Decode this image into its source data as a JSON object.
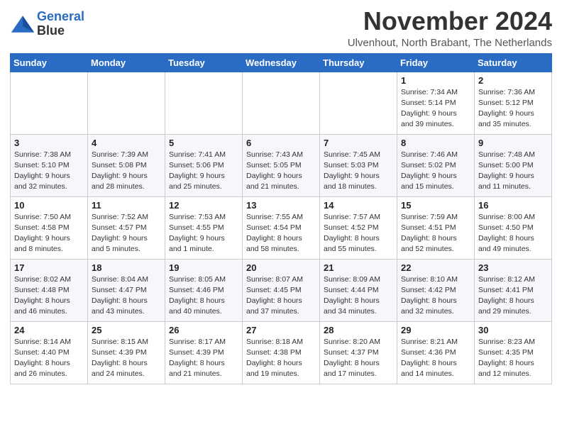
{
  "logo": {
    "line1": "General",
    "line2": "Blue"
  },
  "title": "November 2024",
  "location": "Ulvenhout, North Brabant, The Netherlands",
  "days_of_week": [
    "Sunday",
    "Monday",
    "Tuesday",
    "Wednesday",
    "Thursday",
    "Friday",
    "Saturday"
  ],
  "weeks": [
    [
      {
        "day": "",
        "info": ""
      },
      {
        "day": "",
        "info": ""
      },
      {
        "day": "",
        "info": ""
      },
      {
        "day": "",
        "info": ""
      },
      {
        "day": "",
        "info": ""
      },
      {
        "day": "1",
        "info": "Sunrise: 7:34 AM\nSunset: 5:14 PM\nDaylight: 9 hours\nand 39 minutes."
      },
      {
        "day": "2",
        "info": "Sunrise: 7:36 AM\nSunset: 5:12 PM\nDaylight: 9 hours\nand 35 minutes."
      }
    ],
    [
      {
        "day": "3",
        "info": "Sunrise: 7:38 AM\nSunset: 5:10 PM\nDaylight: 9 hours\nand 32 minutes."
      },
      {
        "day": "4",
        "info": "Sunrise: 7:39 AM\nSunset: 5:08 PM\nDaylight: 9 hours\nand 28 minutes."
      },
      {
        "day": "5",
        "info": "Sunrise: 7:41 AM\nSunset: 5:06 PM\nDaylight: 9 hours\nand 25 minutes."
      },
      {
        "day": "6",
        "info": "Sunrise: 7:43 AM\nSunset: 5:05 PM\nDaylight: 9 hours\nand 21 minutes."
      },
      {
        "day": "7",
        "info": "Sunrise: 7:45 AM\nSunset: 5:03 PM\nDaylight: 9 hours\nand 18 minutes."
      },
      {
        "day": "8",
        "info": "Sunrise: 7:46 AM\nSunset: 5:02 PM\nDaylight: 9 hours\nand 15 minutes."
      },
      {
        "day": "9",
        "info": "Sunrise: 7:48 AM\nSunset: 5:00 PM\nDaylight: 9 hours\nand 11 minutes."
      }
    ],
    [
      {
        "day": "10",
        "info": "Sunrise: 7:50 AM\nSunset: 4:58 PM\nDaylight: 9 hours\nand 8 minutes."
      },
      {
        "day": "11",
        "info": "Sunrise: 7:52 AM\nSunset: 4:57 PM\nDaylight: 9 hours\nand 5 minutes."
      },
      {
        "day": "12",
        "info": "Sunrise: 7:53 AM\nSunset: 4:55 PM\nDaylight: 9 hours\nand 1 minute."
      },
      {
        "day": "13",
        "info": "Sunrise: 7:55 AM\nSunset: 4:54 PM\nDaylight: 8 hours\nand 58 minutes."
      },
      {
        "day": "14",
        "info": "Sunrise: 7:57 AM\nSunset: 4:52 PM\nDaylight: 8 hours\nand 55 minutes."
      },
      {
        "day": "15",
        "info": "Sunrise: 7:59 AM\nSunset: 4:51 PM\nDaylight: 8 hours\nand 52 minutes."
      },
      {
        "day": "16",
        "info": "Sunrise: 8:00 AM\nSunset: 4:50 PM\nDaylight: 8 hours\nand 49 minutes."
      }
    ],
    [
      {
        "day": "17",
        "info": "Sunrise: 8:02 AM\nSunset: 4:48 PM\nDaylight: 8 hours\nand 46 minutes."
      },
      {
        "day": "18",
        "info": "Sunrise: 8:04 AM\nSunset: 4:47 PM\nDaylight: 8 hours\nand 43 minutes."
      },
      {
        "day": "19",
        "info": "Sunrise: 8:05 AM\nSunset: 4:46 PM\nDaylight: 8 hours\nand 40 minutes."
      },
      {
        "day": "20",
        "info": "Sunrise: 8:07 AM\nSunset: 4:45 PM\nDaylight: 8 hours\nand 37 minutes."
      },
      {
        "day": "21",
        "info": "Sunrise: 8:09 AM\nSunset: 4:44 PM\nDaylight: 8 hours\nand 34 minutes."
      },
      {
        "day": "22",
        "info": "Sunrise: 8:10 AM\nSunset: 4:42 PM\nDaylight: 8 hours\nand 32 minutes."
      },
      {
        "day": "23",
        "info": "Sunrise: 8:12 AM\nSunset: 4:41 PM\nDaylight: 8 hours\nand 29 minutes."
      }
    ],
    [
      {
        "day": "24",
        "info": "Sunrise: 8:14 AM\nSunset: 4:40 PM\nDaylight: 8 hours\nand 26 minutes."
      },
      {
        "day": "25",
        "info": "Sunrise: 8:15 AM\nSunset: 4:39 PM\nDaylight: 8 hours\nand 24 minutes."
      },
      {
        "day": "26",
        "info": "Sunrise: 8:17 AM\nSunset: 4:39 PM\nDaylight: 8 hours\nand 21 minutes."
      },
      {
        "day": "27",
        "info": "Sunrise: 8:18 AM\nSunset: 4:38 PM\nDaylight: 8 hours\nand 19 minutes."
      },
      {
        "day": "28",
        "info": "Sunrise: 8:20 AM\nSunset: 4:37 PM\nDaylight: 8 hours\nand 17 minutes."
      },
      {
        "day": "29",
        "info": "Sunrise: 8:21 AM\nSunset: 4:36 PM\nDaylight: 8 hours\nand 14 minutes."
      },
      {
        "day": "30",
        "info": "Sunrise: 8:23 AM\nSunset: 4:35 PM\nDaylight: 8 hours\nand 12 minutes."
      }
    ]
  ]
}
